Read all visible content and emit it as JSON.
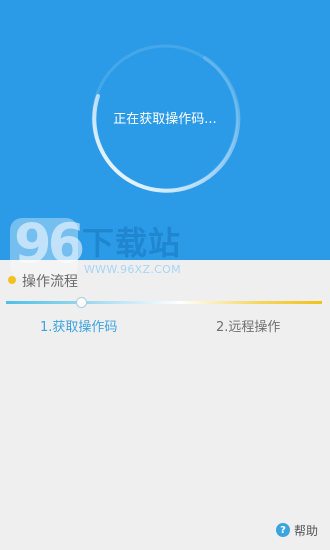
{
  "status": {
    "text": "正在获取操作码..."
  },
  "watermark": {
    "number": "96",
    "title": "下载站",
    "url": "WWW.96XZ.COM"
  },
  "process": {
    "title": "操作流程",
    "progress": 0.24,
    "steps": [
      {
        "label": "1.获取操作码",
        "active": true
      },
      {
        "label": "2.远程操作",
        "active": false
      }
    ]
  },
  "help": {
    "label": "帮助",
    "icon": "question-icon",
    "icon_glyph": "?"
  },
  "colors": {
    "hero": "#2b9be8",
    "accent": "#3aa4df",
    "gold": "#f2c21a",
    "background": "#efefef"
  }
}
